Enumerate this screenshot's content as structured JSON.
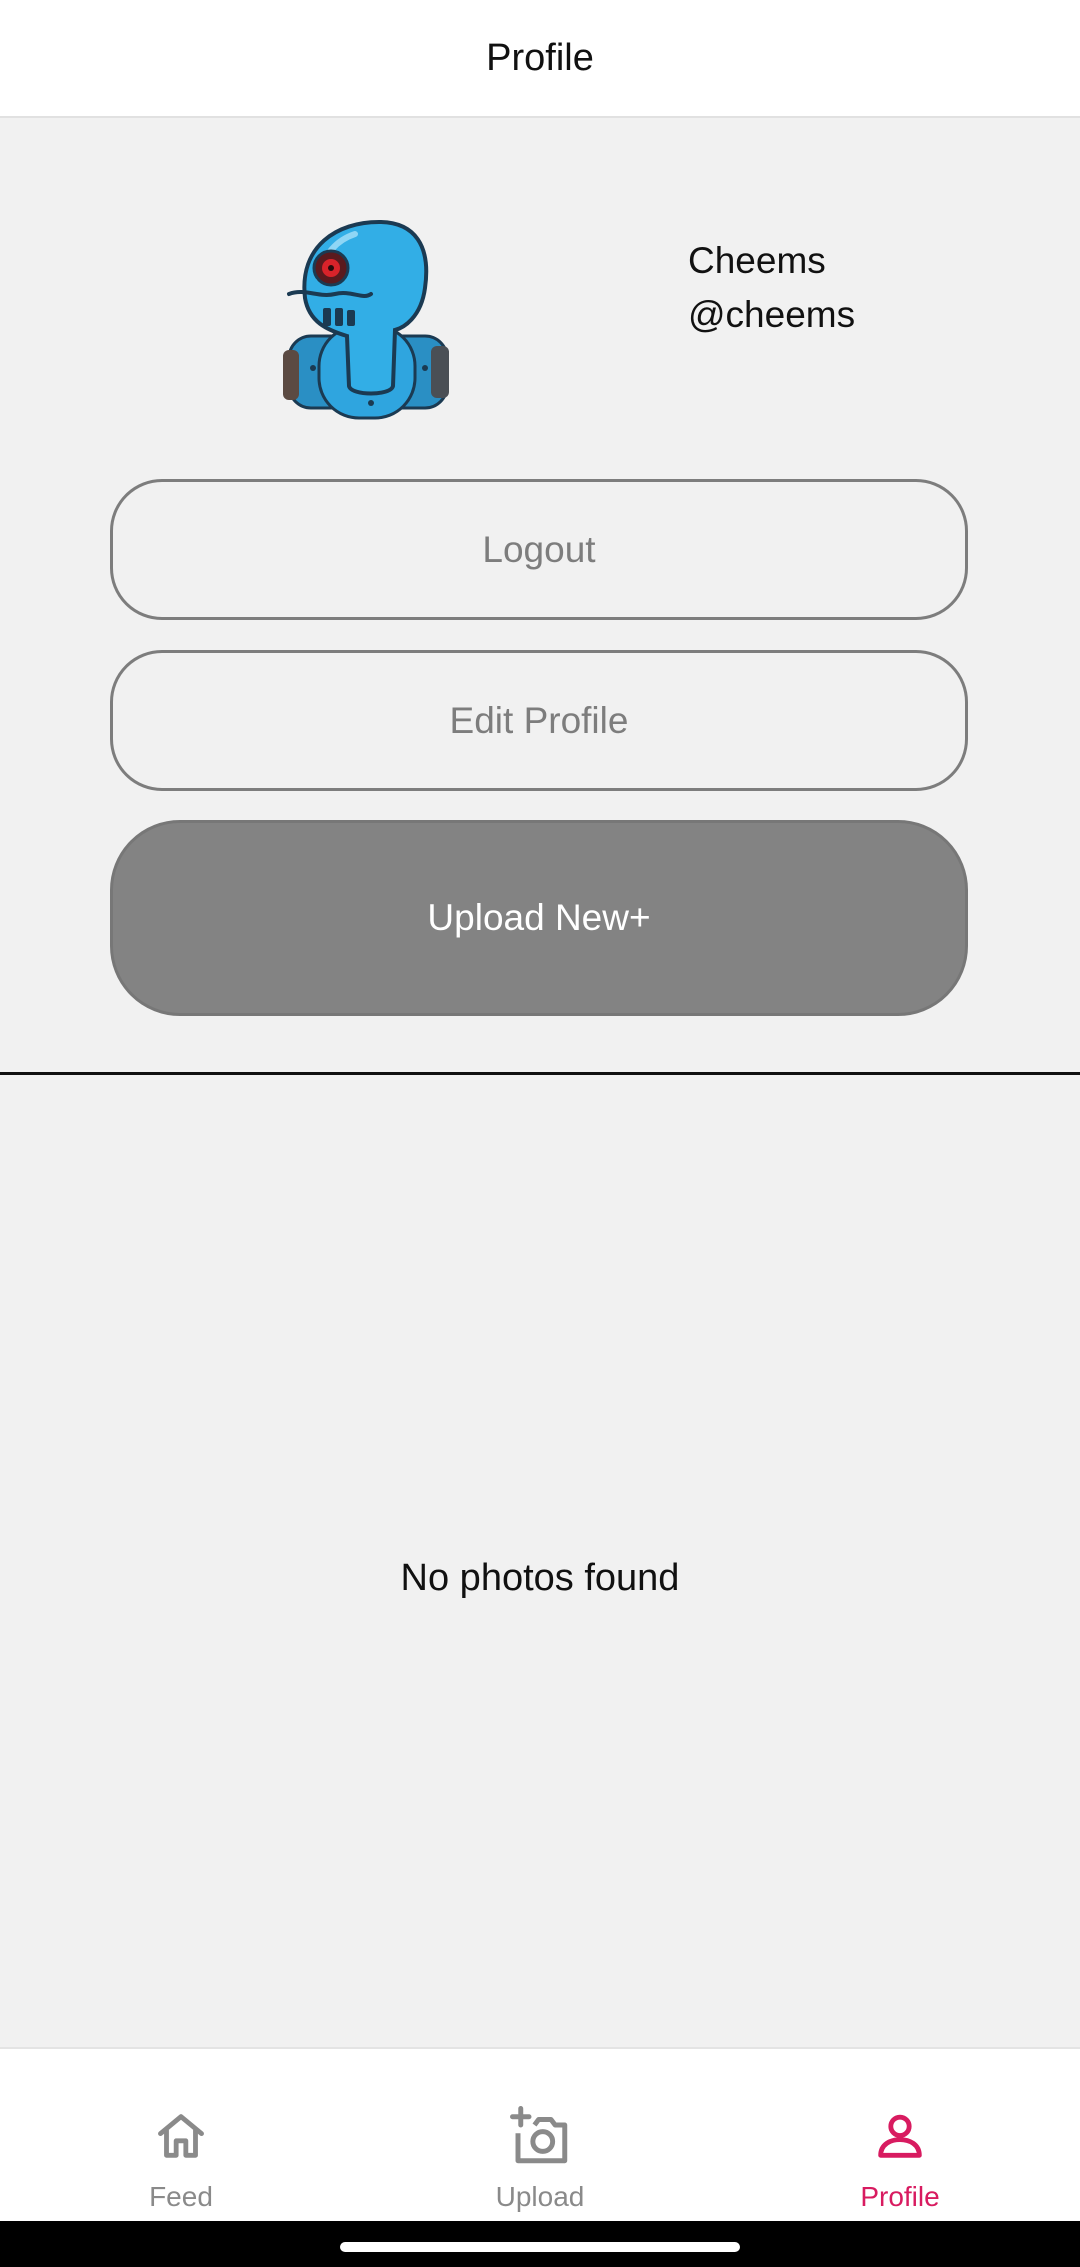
{
  "header": {
    "title": "Profile"
  },
  "profile": {
    "display_name": "Cheems",
    "username": "@cheems",
    "avatar_icon": "robot-avatar-icon"
  },
  "actions": {
    "logout_label": "Logout",
    "edit_profile_label": "Edit Profile",
    "upload_new_label": "Upload New+"
  },
  "gallery": {
    "empty_message": "No photos found"
  },
  "bottom_nav": {
    "items": [
      {
        "label": "Feed",
        "icon": "home-icon",
        "active": false
      },
      {
        "label": "Upload",
        "icon": "add-photo-icon",
        "active": false
      },
      {
        "label": "Profile",
        "icon": "person-icon",
        "active": true
      }
    ]
  },
  "colors": {
    "accent": "#d81b60",
    "background": "#f1f1f1",
    "outline_button": "#7d7d7d",
    "filled_button": "#838383",
    "avatar_body": "#29a8e0"
  }
}
